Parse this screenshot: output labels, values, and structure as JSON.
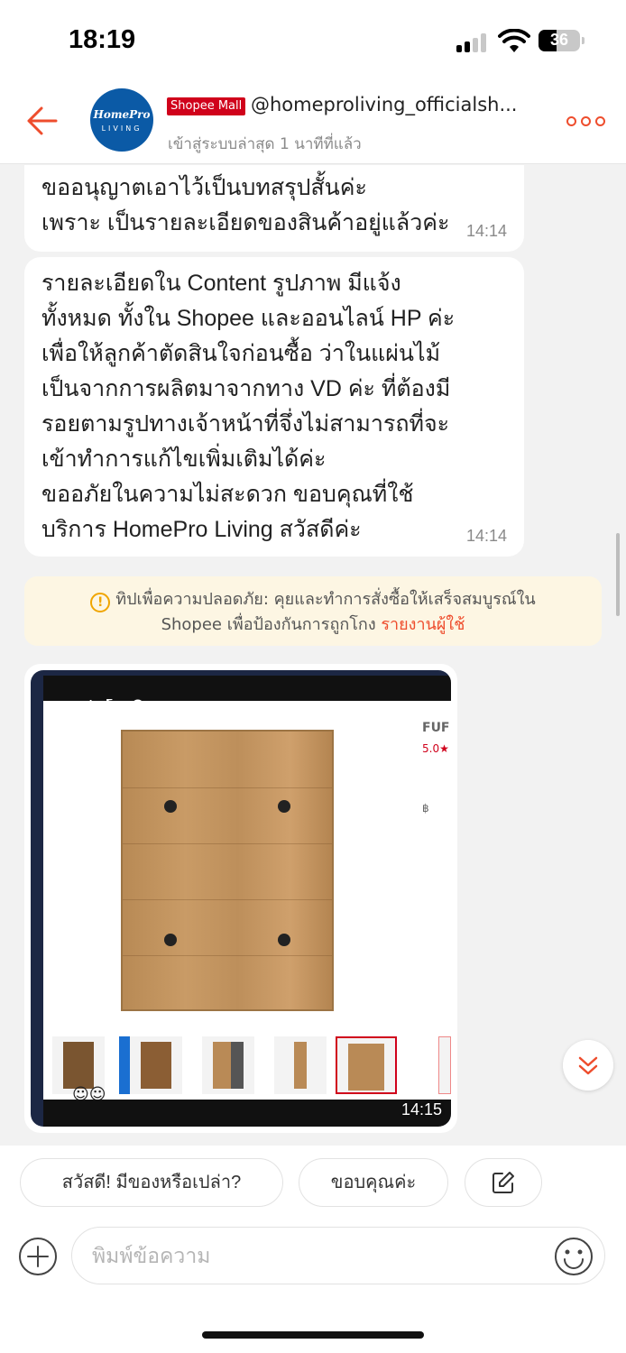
{
  "status": {
    "time": "18:19",
    "battery": "36"
  },
  "header": {
    "avatar_brand": "HomePro",
    "avatar_sub": "LIVING",
    "badge": "Shopee Mall",
    "shop_name": "@homeproliving_officialsh...",
    "last_seen": "เข้าสู่ระบบล่าสุด 1 นาทีที่แล้ว"
  },
  "messages": [
    {
      "text": "ขออนุญาตเอาไว้เป็นบทสรุปสั้นค่ะ\nเพราะ เป็นรายละเอียดของสินค้าอยู่แล้วค่ะ",
      "time": "14:14"
    },
    {
      "text": "รายละเอียดใน Content  รูปภาพ มีแจ้ง\nทั้งหมด ทั้งใน Shopee และออนไลน์ HP  ค่ะ\n  เพื่อให้ลูกค้าตัดสินใจก่อนซื้อ ว่าในแผ่นไม้\nเป็นจากการผลิตมาจากทาง VD ค่ะ  ที่ต้องมี\nรอยตามรูปทางเจ้าหน้าที่จึ่งไม่สามารถที่จะ\nเข้าทำการแก้ไขเพิ่มเติมได้ค่ะ\nขออภัยในความไม่สะดวก ขอบคุณที่ใช้\nบริการ HomePro Living สวัสดีค่ะ",
      "time": "14:14"
    }
  ],
  "safety": {
    "icon": "!",
    "line1": "ทิปเพื่อความปลอดภัย: คุยและทำการสั่งซื้อให้เสร็จสมบูรณ์ใน",
    "line2": "Shopee เพื่อป้องกันการถูกโกง",
    "report": "รายงานผู้ใช้"
  },
  "image_message": {
    "time": "14:15",
    "zoom_tools": "− + ⤡ ⟲",
    "side_text": [
      "FUF",
      "5.0★",
      "฿"
    ]
  },
  "quick_replies": [
    "สวัสดี! มีของหรือเปล่า?",
    "ขอบคุณค่ะ"
  ],
  "input": {
    "placeholder": "พิมพ์ข้อความ"
  },
  "icons": {
    "back": "back-arrow-icon",
    "more": "more-dots-icon",
    "edit": "edit-pencil-icon",
    "add": "plus-circle-icon",
    "emoji": "smiley-icon",
    "scroll": "double-chevron-down-icon"
  },
  "colors": {
    "accent": "#ee4d2d",
    "mall_red": "#d0011b",
    "warning": "#f0a500"
  }
}
